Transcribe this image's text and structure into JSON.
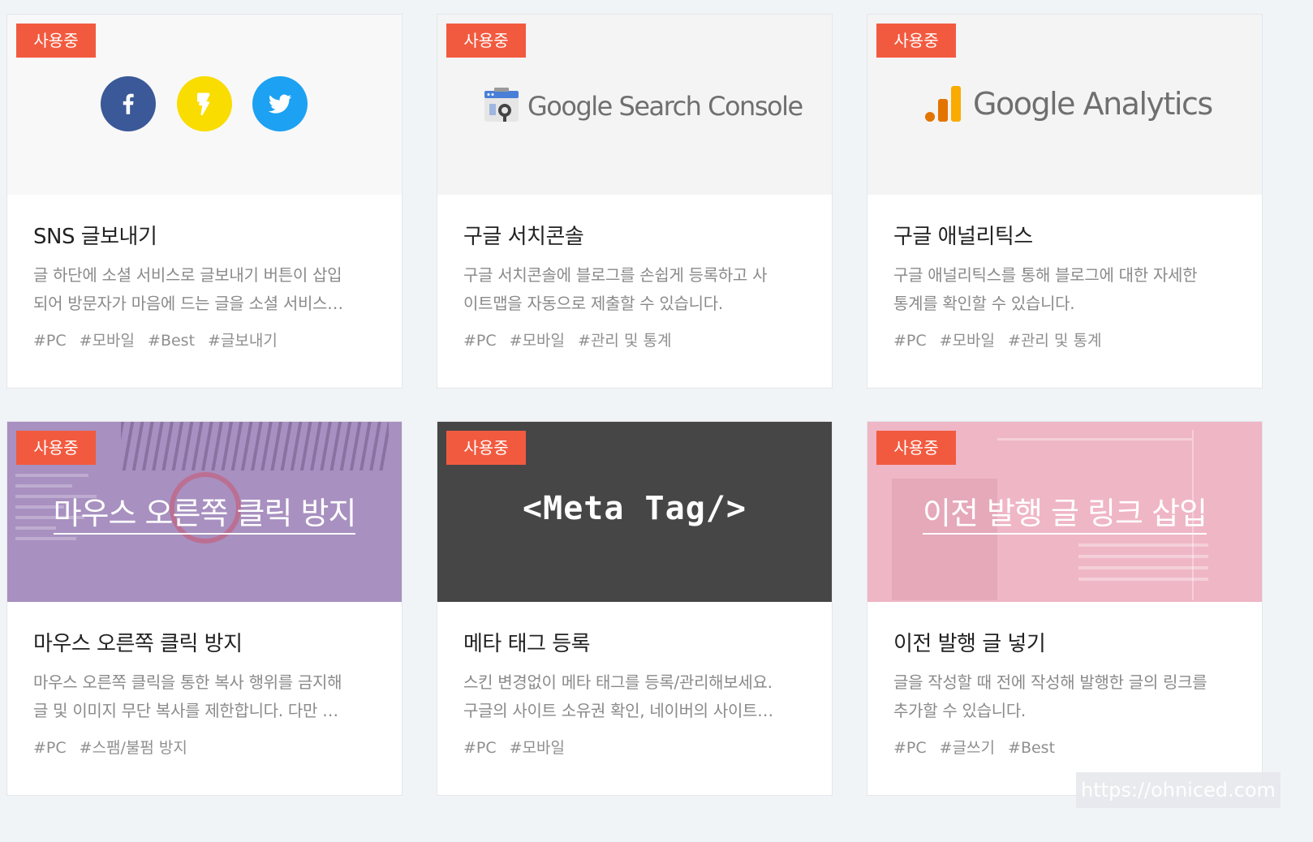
{
  "status_badge": "사용중",
  "cards": [
    {
      "title": "SNS 글보내기",
      "desc_lines": [
        "글 하단에 소셜 서비스로 글보내기 버튼이 삽입",
        "되어 방문자가 마음에 드는 글을 소셜 서비스…"
      ],
      "tags": [
        "#PC",
        "#모바일",
        "#Best",
        "#글보내기"
      ],
      "thumb_icons": [
        "facebook-icon",
        "kakaostory-icon",
        "twitter-icon"
      ]
    },
    {
      "title": "구글 서치콘솔",
      "desc_lines": [
        "구글 서치콘솔에 블로그를 손쉽게 등록하고 사",
        "이트맵을 자동으로 제출할 수 있습니다."
      ],
      "tags": [
        "#PC",
        "#모바일",
        "#관리 및 통계"
      ],
      "logo_text": "Google Search Console"
    },
    {
      "title": "구글 애널리틱스",
      "desc_lines": [
        "구글 애널리틱스를 통해 블로그에 대한 자세한",
        "통계를 확인할 수 있습니다."
      ],
      "tags": [
        "#PC",
        "#모바일",
        "#관리 및 통계"
      ],
      "logo_text": "Google Analytics"
    },
    {
      "title": "마우스 오른쪽 클릭 방지",
      "desc_lines": [
        "마우스 오른쪽 클릭을 통한 복사 행위를 금지해",
        "글 및 이미지 무단 복사를 제한합니다. 다만 …"
      ],
      "tags": [
        "#PC",
        "#스팸/불펌 방지"
      ],
      "thumb_caption": "마우스 오른쪽 클릭 방지"
    },
    {
      "title": "메타 태그 등록",
      "desc_lines": [
        "스킨 변경없이 메타 태그를 등록/관리해보세요.",
        "구글의 사이트 소유권 확인, 네이버의 사이트…"
      ],
      "tags": [
        "#PC",
        "#모바일"
      ],
      "thumb_caption": "<Meta Tag/>"
    },
    {
      "title": "이전 발행 글 넣기",
      "desc_lines": [
        "글을 작성할 때 전에 작성해 발행한 글의 링크를",
        "추가할 수 있습니다."
      ],
      "tags": [
        "#PC",
        "#글쓰기",
        "#Best"
      ],
      "thumb_caption": "이전 발행 글 링크 삽입"
    }
  ],
  "watermark": "https://ohniced.com",
  "colors": {
    "badge": "#f25a3f",
    "facebook": "#3b5998",
    "kakaostory": "#f9dc00",
    "twitter": "#1da1f2",
    "meta_bg": "#464646",
    "mouse_bg": "#a890c0",
    "prev_bg": "#efb6c6"
  }
}
